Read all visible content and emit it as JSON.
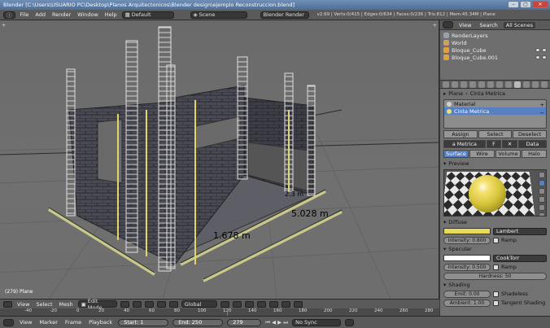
{
  "window": {
    "title": "Blender [C:\\Users\\USUARIO PC\\Desktop\\Planos Arquitectonicos\\Blender design\\ejemplo Reconstruccion.blend]",
    "buttons": [
      "–",
      "▢",
      "✕"
    ]
  },
  "info_header": {
    "menu": [
      "File",
      "Add",
      "Render",
      "Window",
      "Help"
    ],
    "screen_layout": "Default",
    "scene": "Scene",
    "render_engine": "Blender Render",
    "stats": "v2.69 | Verts:0/415 | Edges:0/634 | Faces:0/236 | Tris:812 | Mem:45.34M | Plane"
  },
  "viewport": {
    "object_label": "(279) Plane",
    "measurements": [
      "1.678 m",
      "5.028 m",
      "2.3 m"
    ],
    "colors": {
      "grid": "#5c5c5c",
      "floor_line": "#2a2a2a",
      "block": "#4a4a55",
      "block_edge": "#2a2a30",
      "rebar": "#c8c8c8",
      "yellow_strip": "#d8d88a"
    }
  },
  "view3d_header": {
    "menu": [
      "View",
      "Select",
      "Mesh"
    ],
    "mode": "Edit Mode",
    "orientation": "Global"
  },
  "timeline": {
    "ticks": [
      "-40",
      "-20",
      "0",
      "20",
      "40",
      "60",
      "80",
      "100",
      "120",
      "140",
      "160",
      "180",
      "200",
      "220",
      "240",
      "260",
      "280"
    ],
    "menu": [
      "View",
      "Marker",
      "Frame",
      "Playback"
    ],
    "start": "Start: 1",
    "end": "End: 250",
    "current": "279",
    "sync": "No Sync"
  },
  "outliner": {
    "tabs": [
      "View",
      "Search",
      "All Scenes"
    ],
    "items": [
      {
        "label": "RenderLayers",
        "color": "#9aa0a8"
      },
      {
        "label": "World",
        "color": "#d0a060"
      },
      {
        "label": "Bloque_Cube",
        "color": "#e0a040"
      },
      {
        "label": "Bloque_Cube.001",
        "color": "#e0a040"
      }
    ]
  },
  "properties": {
    "breadcrumb": [
      "Plane",
      "Cinta Metrica"
    ],
    "materials": [
      {
        "label": "Material",
        "color": "#d0d0d0",
        "selected": false
      },
      {
        "label": "Cinta Metrica",
        "color": "#e8e070",
        "selected": true
      }
    ],
    "assign_buttons": [
      "Assign",
      "Select",
      "Deselect"
    ],
    "material_name": "a Metrica",
    "data_label": "Data",
    "render_tabs": [
      "Surface",
      "Wire",
      "Volume",
      "Halo"
    ],
    "preview_title": "Preview",
    "diffuse": {
      "title": "Diffuse",
      "color": "#e7db55",
      "shader": "Lambert",
      "intensity": "Intensity: 0.800",
      "ramp": "Ramp"
    },
    "specular": {
      "title": "Specular",
      "color": "#ffffff",
      "shader": "CookTorr",
      "intensity": "Intensity: 0.500",
      "ramp": "Ramp",
      "hardness": "Hardness: 50"
    },
    "shading": {
      "title": "Shading",
      "emit": "Emit: 0.00",
      "shadeless": "Shadeless",
      "ambient": "Ambient: 1.00",
      "tangent": "Tangent Shading"
    }
  }
}
